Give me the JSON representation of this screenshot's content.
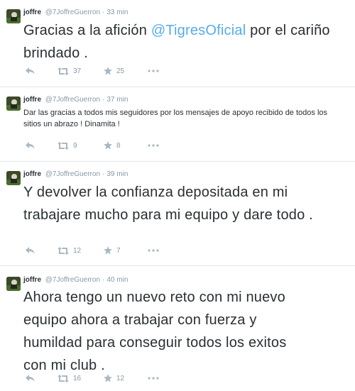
{
  "colors": {
    "text": "#292f33",
    "meta": "#8899a6",
    "icon": "#aab8c2",
    "link": "#55acee",
    "divider": "#e1e8ed"
  },
  "tweets": [
    {
      "fullname": "joffre",
      "username": "@7JoffreGuerron",
      "time": "33 min",
      "text_before": "Gracias a la afición ",
      "mention": "@TigresOficial",
      "text_after": " por el cariño brindado .",
      "retweets": "37",
      "favorites": "25"
    },
    {
      "fullname": "joffre",
      "username": "@7JoffreGuerron",
      "time": "37 min",
      "text": "Dar las gracias a todos mis seguidores por los mensajes de apoyo recibido de todos los sitios un abrazo ! Dinamita !",
      "retweets": "9",
      "favorites": "8"
    },
    {
      "fullname": "joffre",
      "username": "@7JoffreGuerron",
      "time": "39 min",
      "text": "Y devolver la confianza depositada en mi trabajare mucho para mi equipo y dare todo .",
      "retweets": "12",
      "favorites": "7"
    },
    {
      "fullname": "joffre",
      "username": "@7JoffreGuerron",
      "time": "40 min",
      "text": "Ahora tengo un nuevo reto con mi nuevo equipo ahora a trabajar con fuerza y humildad para conseguir todos los exitos con mi club .",
      "retweets": "16",
      "favorites": "12"
    }
  ],
  "icons": {
    "reply": "reply-icon",
    "retweet": "retweet-icon",
    "favorite": "star-icon",
    "more": "more-icon"
  }
}
